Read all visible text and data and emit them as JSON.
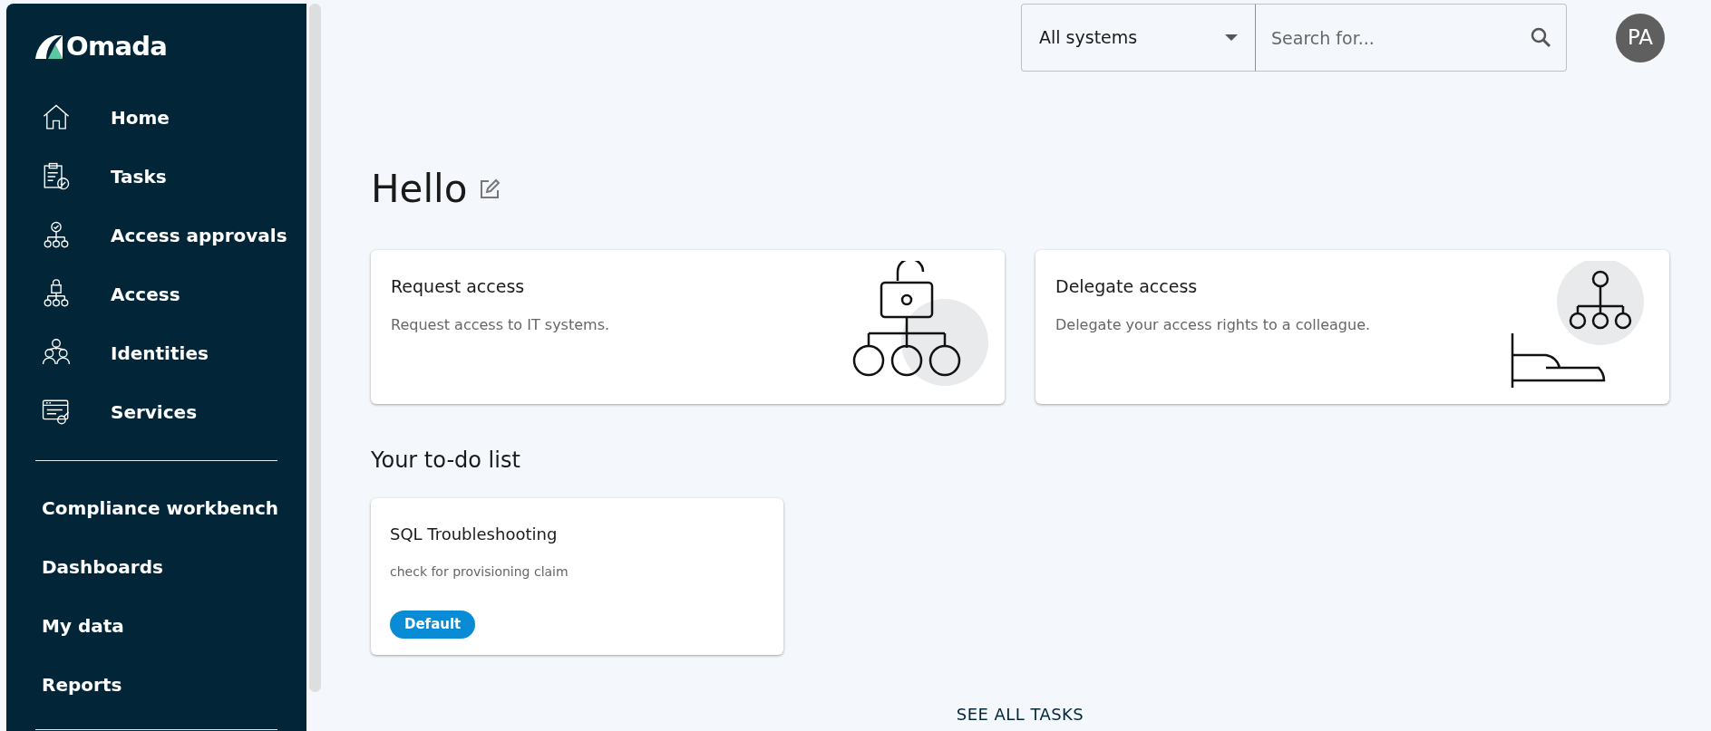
{
  "sidebar": {
    "logo": "Omada",
    "main_items": [
      {
        "label": "Home"
      },
      {
        "label": "Tasks"
      },
      {
        "label": "Access approvals"
      },
      {
        "label": "Access"
      },
      {
        "label": "Identities"
      },
      {
        "label": "Services"
      }
    ],
    "secondary_items": [
      {
        "label": "Compliance workbench"
      },
      {
        "label": "Dashboards"
      },
      {
        "label": "My data"
      },
      {
        "label": "Reports"
      }
    ]
  },
  "header": {
    "system_select": "All systems",
    "search": {
      "placeholder": "Search for..."
    },
    "avatar": "PA"
  },
  "greeting": "Hello",
  "action_cards": [
    {
      "title": "Request access",
      "description": "Request access to IT systems."
    },
    {
      "title": "Delegate access",
      "description": "Delegate your access rights to a colleague."
    }
  ],
  "todo": {
    "heading": "Your to-do list",
    "tasks": [
      {
        "title": "SQL Troubleshooting",
        "description": "check for provisioning claim",
        "tag": "Default"
      }
    ],
    "see_all": "SEE ALL TASKS"
  }
}
